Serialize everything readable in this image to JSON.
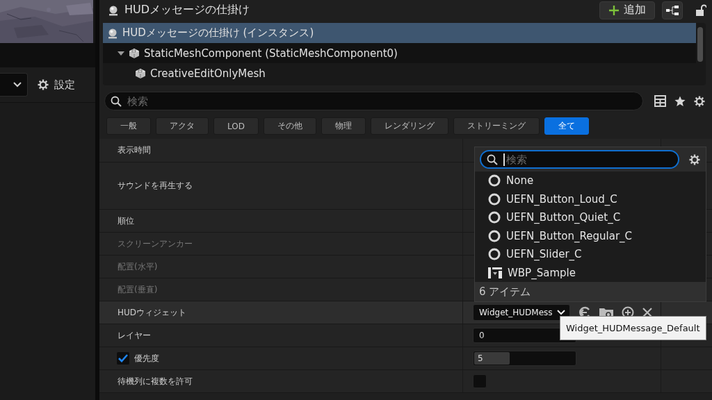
{
  "left_toolbar": {
    "settings_button": "設定"
  },
  "details": {
    "title": "HUDメッセージの仕掛け",
    "add_button": "追加",
    "tree": [
      {
        "label": "HUDメッセージの仕掛け (インスタンス)",
        "kind": "actor",
        "selected": true,
        "children": [
          {
            "label": "StaticMeshComponent (StaticMeshComponent0)",
            "kind": "mesh",
            "selected": false,
            "expanded": true,
            "children": [
              {
                "label": "CreativeEditOnlyMesh",
                "kind": "mesh",
                "selected": false
              }
            ]
          }
        ]
      }
    ],
    "search": {
      "placeholder": "検索"
    },
    "filters": [
      {
        "label": "一般",
        "selected": false
      },
      {
        "label": "アクタ",
        "selected": false
      },
      {
        "label": "LOD",
        "selected": false
      },
      {
        "label": "その他",
        "selected": false
      },
      {
        "label": "物理",
        "selected": false
      },
      {
        "label": "レンダリング",
        "selected": false
      },
      {
        "label": "ストリーミング",
        "selected": false
      },
      {
        "label": "全て",
        "selected": true
      }
    ],
    "properties": [
      {
        "label": "表示時間",
        "kind": "covered",
        "disabled": false
      },
      {
        "label": "サウンドを再生する",
        "kind": "sound",
        "disabled": false
      },
      {
        "label": "順位",
        "kind": "covered",
        "disabled": false
      },
      {
        "label": "スクリーンアンカー",
        "kind": "covered",
        "disabled": true
      },
      {
        "label": "配置(水平)",
        "kind": "covered",
        "disabled": true
      },
      {
        "label": "配置(垂直)",
        "kind": "covered",
        "disabled": true
      },
      {
        "label": "HUDウィジェット",
        "kind": "asset",
        "disabled": false,
        "hovered": true,
        "value": "Widget_HUDMess"
      },
      {
        "label": "レイヤー",
        "kind": "number",
        "disabled": false,
        "value": "0"
      },
      {
        "label": "優先度",
        "kind": "slider",
        "disabled": false,
        "edit_checked": true,
        "value": "5",
        "level": 0.35
      },
      {
        "label": "待機列に複数を許可",
        "kind": "checkbox",
        "disabled": false,
        "checked": false
      }
    ],
    "picker": {
      "search_placeholder": "検索",
      "items": [
        {
          "label": "None",
          "kind": "class"
        },
        {
          "label": "UEFN_Button_Loud_C",
          "kind": "class"
        },
        {
          "label": "UEFN_Button_Quiet_C",
          "kind": "class"
        },
        {
          "label": "UEFN_Button_Regular_C",
          "kind": "class"
        },
        {
          "label": "UEFN_Slider_C",
          "kind": "class"
        },
        {
          "label": "WBP_Sample",
          "kind": "blueprint"
        }
      ],
      "count": "6 アイテム"
    },
    "tooltip": "Widget_HUDMessage_Default"
  }
}
